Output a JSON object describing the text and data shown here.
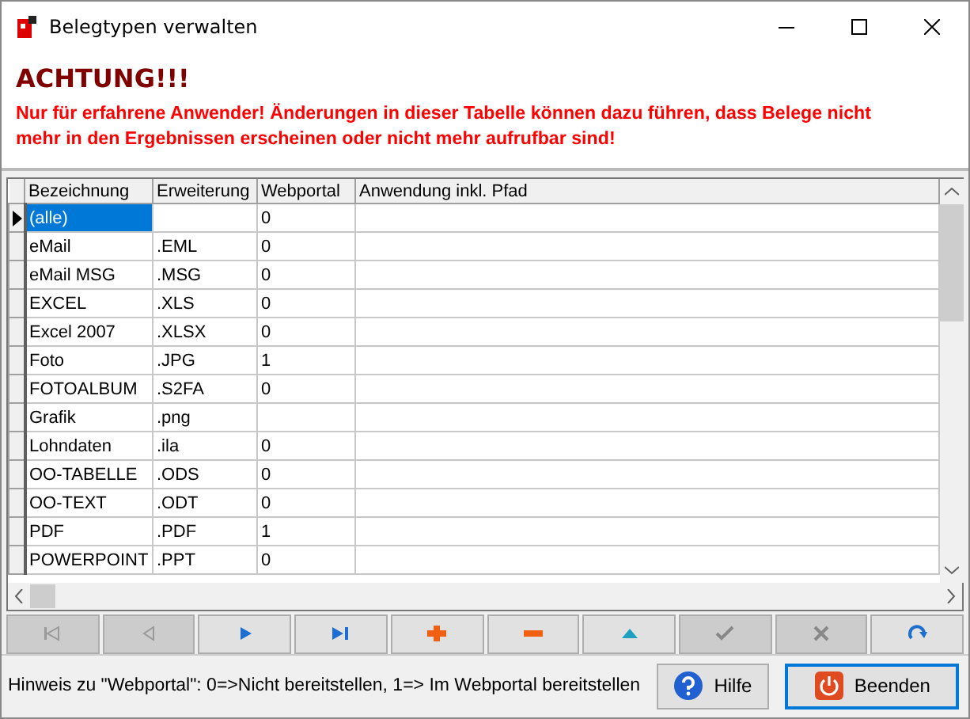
{
  "window": {
    "title": "Belegtypen verwalten"
  },
  "warning": {
    "heading": "ACHTUNG!!!",
    "text": "Nur für erfahrene Anwender! Änderungen in dieser Tabelle können dazu führen, dass Belege nicht mehr in den Ergebnissen erscheinen oder nicht mehr aufrufbar sind!"
  },
  "table": {
    "columns": [
      "Bezeichnung",
      "Erweiterung",
      "Webportal",
      "Anwendung inkl. Pfad"
    ],
    "rows": [
      {
        "cells": [
          "(alle)",
          "",
          "0",
          ""
        ],
        "selected": true
      },
      {
        "cells": [
          "eMail",
          ".EML",
          "0",
          ""
        ],
        "selected": false
      },
      {
        "cells": [
          "eMail MSG",
          ".MSG",
          "0",
          ""
        ],
        "selected": false
      },
      {
        "cells": [
          "EXCEL",
          ".XLS",
          "0",
          ""
        ],
        "selected": false
      },
      {
        "cells": [
          "Excel 2007",
          ".XLSX",
          "0",
          ""
        ],
        "selected": false
      },
      {
        "cells": [
          "Foto",
          ".JPG",
          "1",
          ""
        ],
        "selected": false
      },
      {
        "cells": [
          "FOTOALBUM",
          ".S2FA",
          "0",
          ""
        ],
        "selected": false
      },
      {
        "cells": [
          "Grafik",
          ".png",
          "",
          ""
        ],
        "selected": false
      },
      {
        "cells": [
          "Lohndaten",
          ".ila",
          "0",
          ""
        ],
        "selected": false
      },
      {
        "cells": [
          "OO-TABELLE",
          ".ODS",
          "0",
          ""
        ],
        "selected": false
      },
      {
        "cells": [
          "OO-TEXT",
          ".ODT",
          "0",
          ""
        ],
        "selected": false
      },
      {
        "cells": [
          "PDF",
          ".PDF",
          "1",
          ""
        ],
        "selected": false
      },
      {
        "cells": [
          "POWERPOINT",
          ".PPT",
          "0",
          ""
        ],
        "selected": false
      }
    ]
  },
  "navigator": [
    {
      "kind": "first",
      "disabled": true
    },
    {
      "kind": "prior",
      "disabled": true
    },
    {
      "kind": "next",
      "disabled": false
    },
    {
      "kind": "last",
      "disabled": false
    },
    {
      "kind": "insert",
      "disabled": false
    },
    {
      "kind": "delete",
      "disabled": false
    },
    {
      "kind": "edit",
      "disabled": false
    },
    {
      "kind": "post",
      "disabled": true
    },
    {
      "kind": "cancel",
      "disabled": true
    },
    {
      "kind": "refresh",
      "disabled": false
    }
  ],
  "footer": {
    "hint": "Hinweis zu \"Webportal\": 0=>Nicht bereitstellen, 1=> Im Webportal bereitstellen",
    "buttons": [
      {
        "kind": "help",
        "label": "Hilfe",
        "focused": false
      },
      {
        "kind": "exit",
        "label": "Beenden",
        "focused": true
      }
    ]
  }
}
